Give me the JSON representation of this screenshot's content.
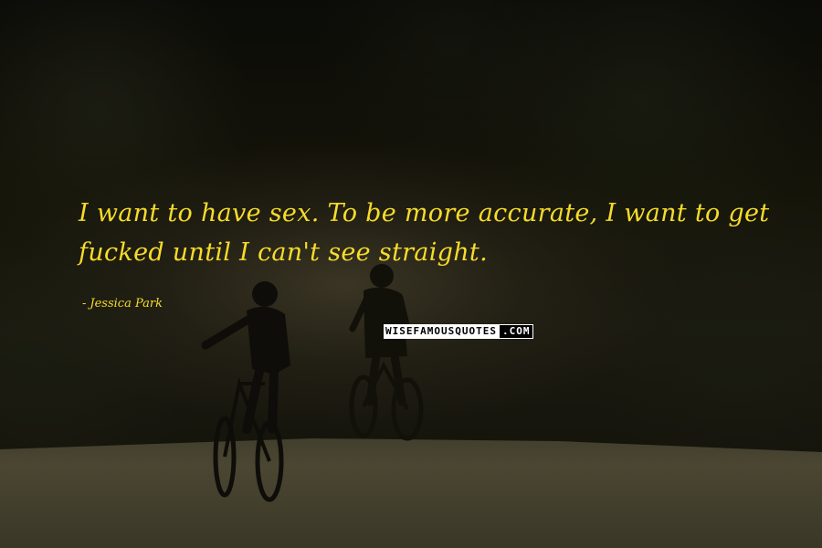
{
  "quote": {
    "text": "I want to have sex. To be more accurate, I want to get fucked until I can't see straight.",
    "author": "Jessica Park",
    "author_prefix": "-"
  },
  "watermark": {
    "main": "WISEFAMOUSQUOTES",
    "suffix": ".COM"
  },
  "colors": {
    "quote_text": "#f6dc2a",
    "background": "#0d0c08"
  }
}
